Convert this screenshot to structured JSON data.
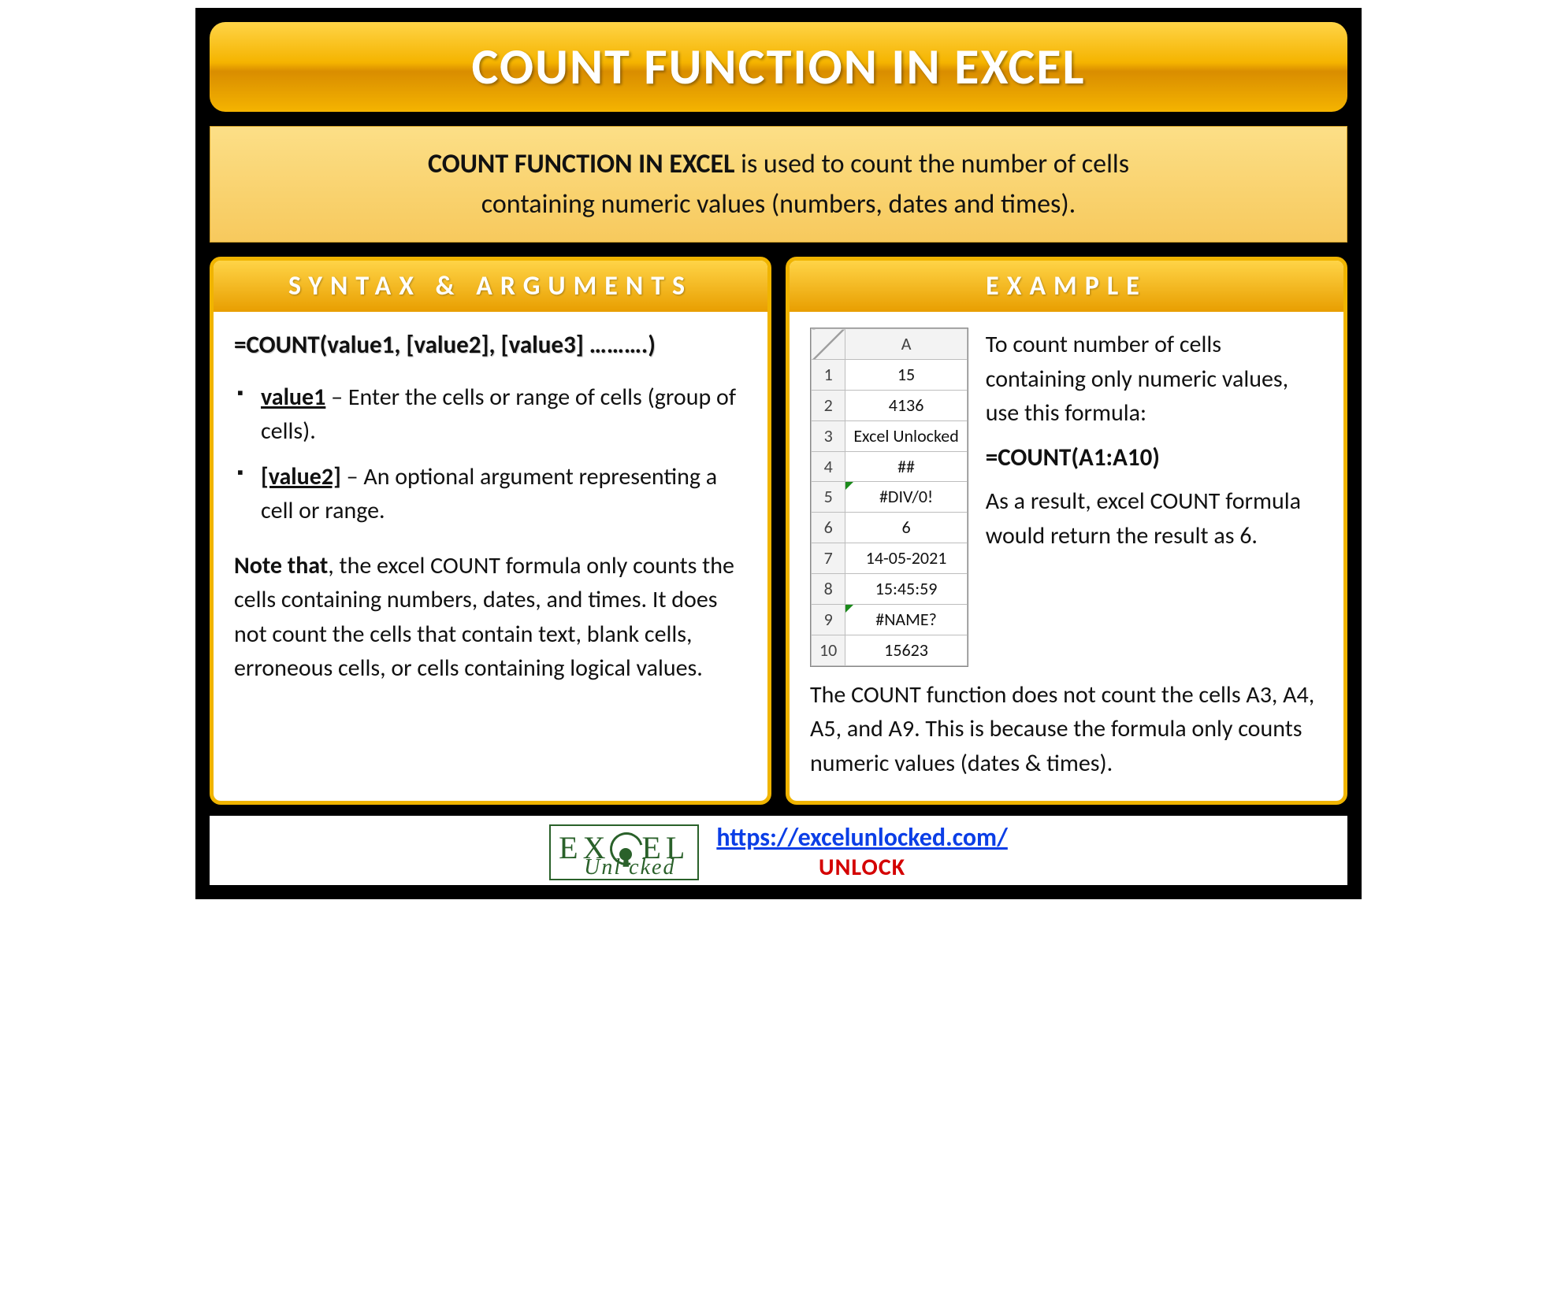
{
  "title": "COUNT FUNCTION IN EXCEL",
  "intro": {
    "strong": "COUNT FUNCTION IN EXCEL",
    "rest1": " is used to count the number of cells",
    "rest2": "containing numeric values (numbers, dates and times)."
  },
  "syntax": {
    "header": "SYNTAX & ARGUMENTS",
    "formula": "=COUNT(value1, [value2], [value3] ……….)",
    "args": [
      {
        "name": "value1",
        "desc": " – Enter the cells or range of cells (group of cells)."
      },
      {
        "name": "[value2]",
        "desc": " – An optional argument representing a cell or range."
      }
    ],
    "note_strong": "Note that",
    "note_rest": ", the excel COUNT formula only counts the cells containing numbers, dates, and times. It does not count the cells that contain text, blank cells, erroneous cells, or cells containing logical values."
  },
  "example": {
    "header": "EXAMPLE",
    "sheet": {
      "col": "A",
      "rows": [
        {
          "n": "1",
          "v": "15",
          "tri": false
        },
        {
          "n": "2",
          "v": "4136",
          "tri": false
        },
        {
          "n": "3",
          "v": "Excel Unlocked",
          "tri": false
        },
        {
          "n": "4",
          "v": "##",
          "tri": false
        },
        {
          "n": "5",
          "v": "#DIV/0!",
          "tri": true
        },
        {
          "n": "6",
          "v": "6",
          "tri": false
        },
        {
          "n": "7",
          "v": "14-05-2021",
          "tri": false
        },
        {
          "n": "8",
          "v": "15:45:59",
          "tri": false
        },
        {
          "n": "9",
          "v": "#NAME?",
          "tri": true
        },
        {
          "n": "10",
          "v": "15623",
          "tri": false
        }
      ]
    },
    "side_intro": "To count number of cells containing only numeric values, use this formula:",
    "side_formula": "=COUNT(A1:A10)",
    "side_result": "As a result, excel COUNT formula would return the result as 6.",
    "below": "The COUNT function does not count the cells A3, A4, A5, and A9. This is because the formula only counts numeric values (dates & times)."
  },
  "footer": {
    "logo_top_left": "EX",
    "logo_top_right": "EL",
    "logo_bottom": "Unl   cked",
    "url": "https://excelunlocked.com/",
    "unlock": "UNLOCK"
  }
}
